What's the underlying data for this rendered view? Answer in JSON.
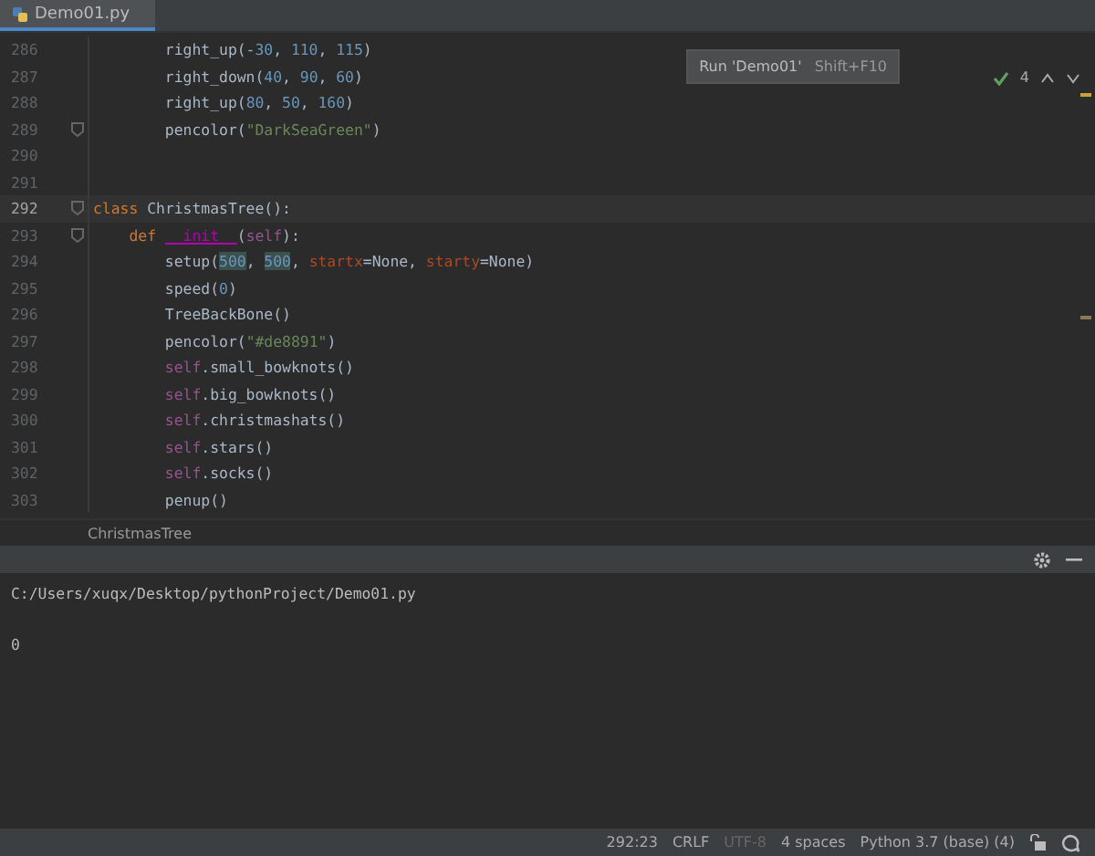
{
  "tabs": [
    {
      "label": "Demo01.py",
      "selected": true
    }
  ],
  "tooltip": {
    "text": "Run 'Demo01'",
    "shortcut": "Shift+F10"
  },
  "inspections": {
    "count": "4"
  },
  "editor": {
    "lines": [
      {
        "number": "286",
        "current": false,
        "fold": false,
        "tokens": [
          {
            "kind": "plain",
            "text": "        right_up(-"
          },
          {
            "kind": "num",
            "text": "30"
          },
          {
            "kind": "plain",
            "text": ", "
          },
          {
            "kind": "num",
            "text": "110"
          },
          {
            "kind": "plain",
            "text": ", "
          },
          {
            "kind": "num",
            "text": "115"
          },
          {
            "kind": "plain",
            "text": ")"
          }
        ]
      },
      {
        "number": "287",
        "current": false,
        "fold": false,
        "tokens": [
          {
            "kind": "plain",
            "text": "        right_down("
          },
          {
            "kind": "num",
            "text": "40"
          },
          {
            "kind": "plain",
            "text": ", "
          },
          {
            "kind": "num",
            "text": "90"
          },
          {
            "kind": "plain",
            "text": ", "
          },
          {
            "kind": "num",
            "text": "60"
          },
          {
            "kind": "plain",
            "text": ")"
          }
        ]
      },
      {
        "number": "288",
        "current": false,
        "fold": false,
        "tokens": [
          {
            "kind": "plain",
            "text": "        right_up("
          },
          {
            "kind": "num",
            "text": "80"
          },
          {
            "kind": "plain",
            "text": ", "
          },
          {
            "kind": "num",
            "text": "50"
          },
          {
            "kind": "plain",
            "text": ", "
          },
          {
            "kind": "num",
            "text": "160"
          },
          {
            "kind": "plain",
            "text": ")"
          }
        ]
      },
      {
        "number": "289",
        "current": false,
        "fold": true,
        "tokens": [
          {
            "kind": "plain",
            "text": "        pencolor("
          },
          {
            "kind": "str",
            "text": "\"DarkSeaGreen\""
          },
          {
            "kind": "plain",
            "text": ")"
          }
        ]
      },
      {
        "number": "290",
        "current": false,
        "fold": false
      },
      {
        "number": "291",
        "current": false,
        "fold": false
      },
      {
        "number": "292",
        "current": true,
        "fold": true,
        "tokens": [
          {
            "kind": "kw",
            "text": "class"
          },
          {
            "kind": "plain",
            "text": " ChristmasTree():"
          }
        ]
      },
      {
        "number": "293",
        "current": false,
        "fold": true,
        "tokens": [
          {
            "kind": "kw",
            "text": "    def "
          },
          {
            "kind": "magic",
            "text": "__init__"
          },
          {
            "kind": "plain",
            "text": "("
          },
          {
            "kind": "self",
            "text": "self"
          },
          {
            "kind": "plain",
            "text": "):"
          }
        ]
      },
      {
        "number": "294",
        "current": false,
        "fold": false,
        "tokens": [
          {
            "kind": "plain",
            "text": "        setup("
          },
          {
            "kind": "hl",
            "text": "500"
          },
          {
            "kind": "plain",
            "text": ", "
          },
          {
            "kind": "hl",
            "text": "500"
          },
          {
            "kind": "plain",
            "text": ", "
          },
          {
            "kind": "param",
            "text": "startx"
          },
          {
            "kind": "plain",
            "text": "=None, "
          },
          {
            "kind": "param",
            "text": "starty"
          },
          {
            "kind": "plain",
            "text": "=None)"
          }
        ]
      },
      {
        "number": "295",
        "current": false,
        "fold": false,
        "tokens": [
          {
            "kind": "plain",
            "text": "        speed("
          },
          {
            "kind": "num",
            "text": "0"
          },
          {
            "kind": "plain",
            "text": ")"
          }
        ]
      },
      {
        "number": "296",
        "current": false,
        "fold": false,
        "tokens": [
          {
            "kind": "plain",
            "text": "        TreeBackBone()"
          }
        ]
      },
      {
        "number": "297",
        "current": false,
        "fold": false,
        "tokens": [
          {
            "kind": "plain",
            "text": "        pencolor("
          },
          {
            "kind": "str",
            "text": "\"#de8891\""
          },
          {
            "kind": "plain",
            "text": ")"
          }
        ]
      },
      {
        "number": "298",
        "current": false,
        "fold": false,
        "tokens": [
          {
            "kind": "self",
            "text": "        self"
          },
          {
            "kind": "plain",
            "text": ".small_bowknots()"
          }
        ]
      },
      {
        "number": "299",
        "current": false,
        "fold": false,
        "tokens": [
          {
            "kind": "self",
            "text": "        self"
          },
          {
            "kind": "plain",
            "text": ".big_bowknots()"
          }
        ]
      },
      {
        "number": "300",
        "current": false,
        "fold": false,
        "tokens": [
          {
            "kind": "self",
            "text": "        self"
          },
          {
            "kind": "plain",
            "text": ".christmashats()"
          }
        ]
      },
      {
        "number": "301",
        "current": false,
        "fold": false,
        "tokens": [
          {
            "kind": "self",
            "text": "        self"
          },
          {
            "kind": "plain",
            "text": ".stars()"
          }
        ]
      },
      {
        "number": "302",
        "current": false,
        "fold": false,
        "tokens": [
          {
            "kind": "self",
            "text": "        self"
          },
          {
            "kind": "plain",
            "text": ".socks()"
          }
        ]
      },
      {
        "number": "303",
        "current": false,
        "fold": false,
        "tokens": [
          {
            "kind": "plain",
            "text": "        penup()"
          }
        ]
      }
    ]
  },
  "breadcrumb": "ChristmasTree",
  "console": {
    "lines": [
      "C:/Users/xuqx/Desktop/pythonProject/Demo01.py",
      "0"
    ]
  },
  "status_bar": [
    {
      "text": "292:23",
      "disabled": false
    },
    {
      "text": "CRLF",
      "disabled": false
    },
    {
      "text": "UTF-8",
      "disabled": true
    },
    {
      "text": "4 spaces",
      "disabled": false
    },
    {
      "text": "Python 3.7 (base) (4)",
      "disabled": false
    }
  ]
}
